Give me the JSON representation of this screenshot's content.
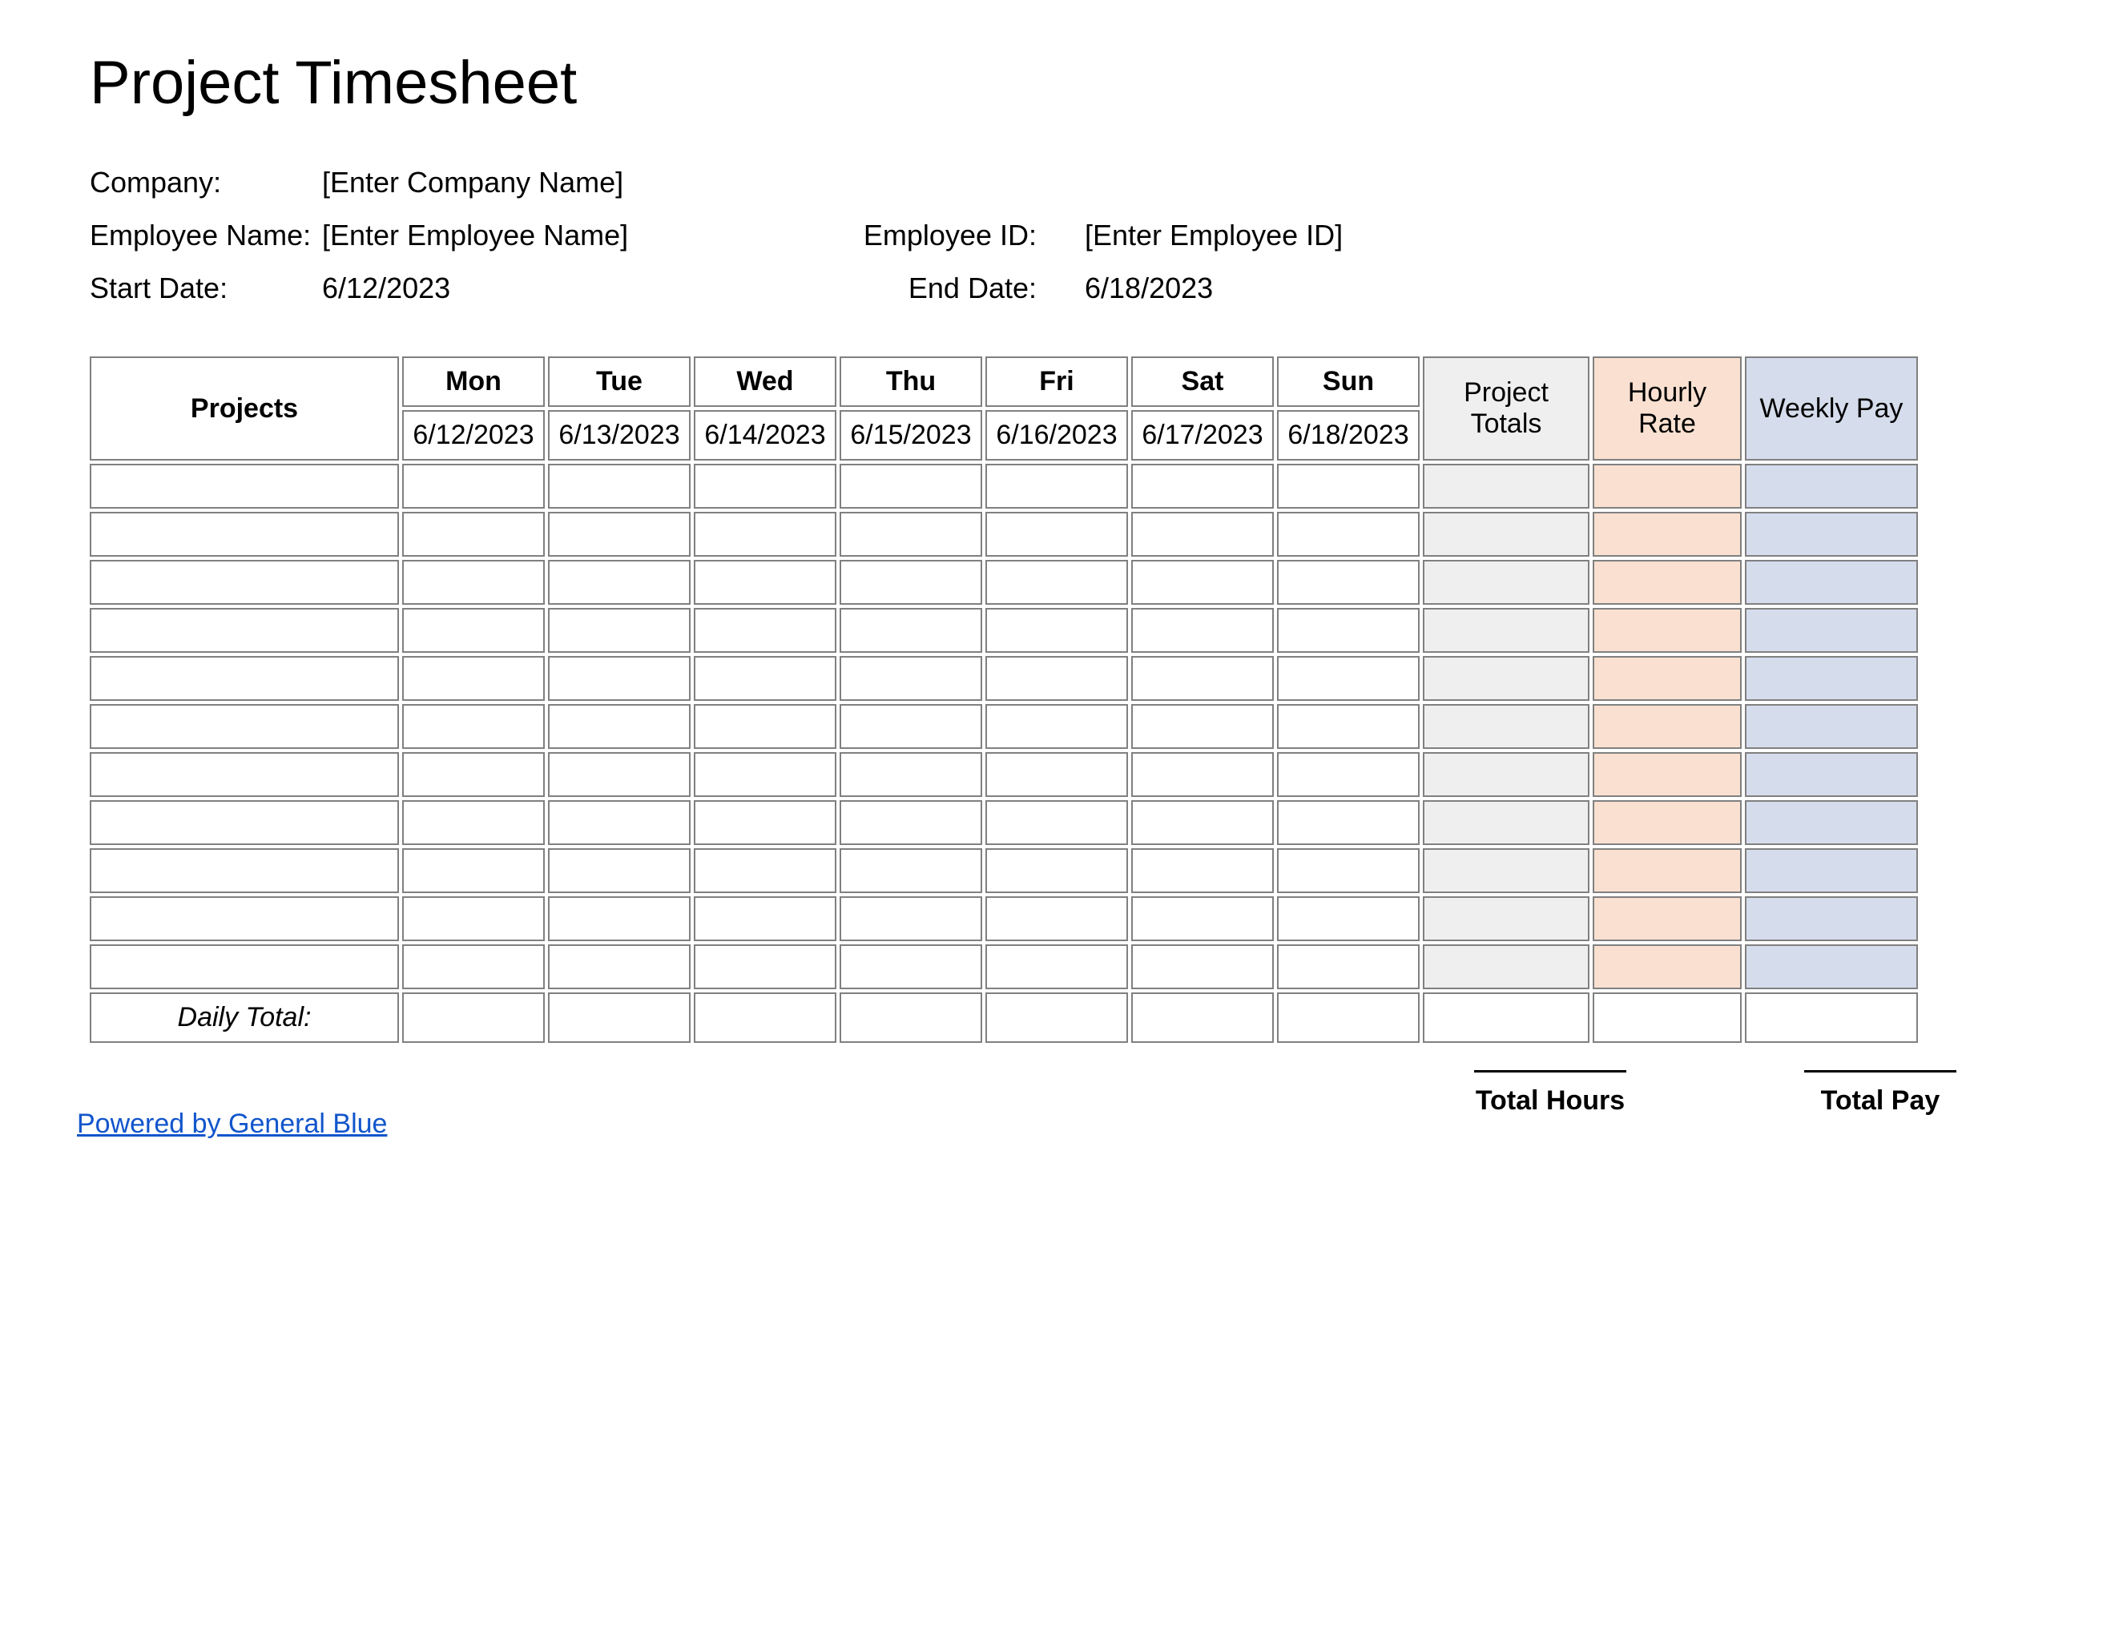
{
  "title": "Project Timesheet",
  "info": {
    "company_label": "Company:",
    "company_value": "[Enter Company Name]",
    "employee_name_label": "Employee Name:",
    "employee_name_value": "[Enter Employee Name]",
    "employee_id_label": "Employee ID:",
    "employee_id_value": "[Enter Employee ID]",
    "start_date_label": "Start Date:",
    "start_date_value": "6/12/2023",
    "end_date_label": "End Date:",
    "end_date_value": "6/18/2023"
  },
  "table": {
    "projects_header": "Projects",
    "days": [
      {
        "name": "Mon",
        "date": "6/12/2023"
      },
      {
        "name": "Tue",
        "date": "6/13/2023"
      },
      {
        "name": "Wed",
        "date": "6/14/2023"
      },
      {
        "name": "Thu",
        "date": "6/15/2023"
      },
      {
        "name": "Fri",
        "date": "6/16/2023"
      },
      {
        "name": "Sat",
        "date": "6/17/2023"
      },
      {
        "name": "Sun",
        "date": "6/18/2023"
      }
    ],
    "project_totals_header": "Project Totals",
    "hourly_rate_header": "Hourly Rate",
    "weekly_pay_header": "Weekly Pay",
    "row_count": 11,
    "daily_total_label": "Daily Total:"
  },
  "footer": {
    "link_text": "Powered by General Blue",
    "total_hours_label": "Total Hours",
    "total_pay_label": "Total Pay"
  }
}
